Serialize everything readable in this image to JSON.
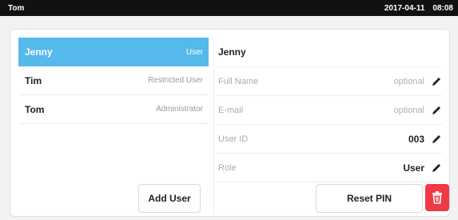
{
  "status_bar": {
    "user": "Tom",
    "date": "2017-04-11",
    "time": "08:08"
  },
  "users": [
    {
      "name": "Jenny",
      "role": "User",
      "selected": true
    },
    {
      "name": "Tim",
      "role": "Restricted User",
      "selected": false
    },
    {
      "name": "Tom",
      "role": "Administrator",
      "selected": false
    }
  ],
  "add_user_label": "Add User",
  "details": {
    "title": "Jenny",
    "fields": [
      {
        "label": "Full Name",
        "value": "optional",
        "is_placeholder": true
      },
      {
        "label": "E-mail",
        "value": "optional",
        "is_placeholder": true
      },
      {
        "label": "User ID",
        "value": "003",
        "is_placeholder": false
      },
      {
        "label": "Role",
        "value": "User",
        "is_placeholder": false
      }
    ]
  },
  "reset_pin_label": "Reset PIN",
  "icons": {
    "edit": "pencil-icon",
    "delete": "trash-icon"
  },
  "colors": {
    "selected": "#55b9ec",
    "danger": "#ef3947"
  }
}
